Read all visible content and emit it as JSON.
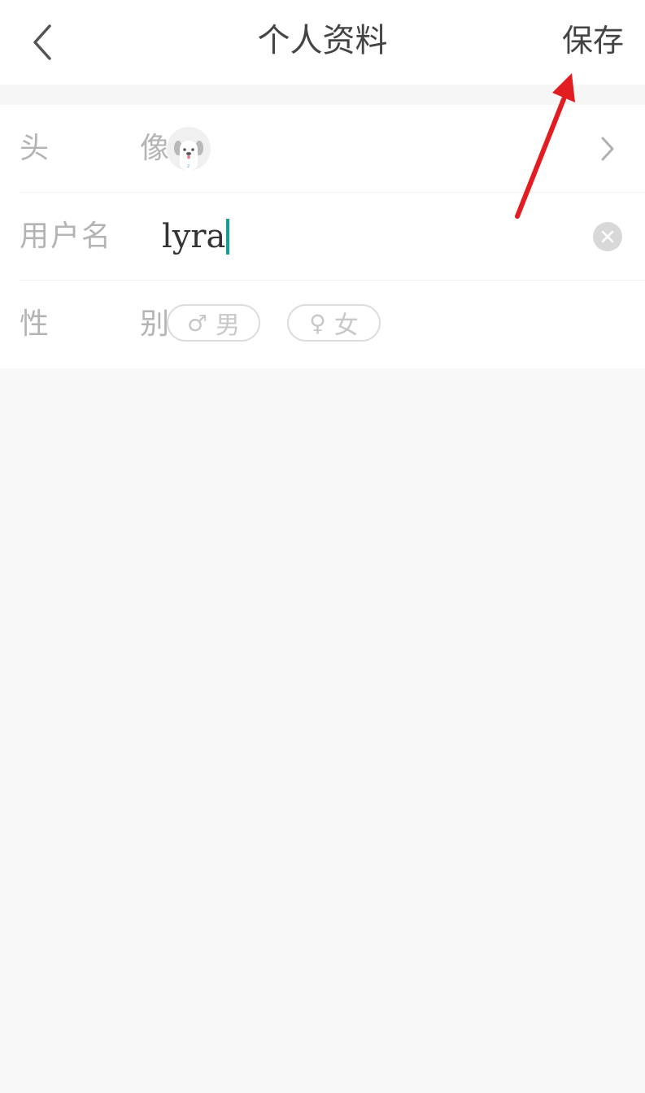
{
  "header": {
    "title": "个人资料",
    "save_label": "保存",
    "back_icon": "chevron-left-icon"
  },
  "form": {
    "avatar": {
      "label": "头　像",
      "icon": "dog-avatar-icon"
    },
    "username": {
      "label": "用户名",
      "value": "lyra"
    },
    "gender": {
      "label": "性　别",
      "options": [
        {
          "symbol": "♂",
          "label": "男"
        },
        {
          "symbol": "♀",
          "label": "女"
        }
      ]
    }
  },
  "colors": {
    "caret": "#13a08f",
    "annotation_arrow": "#e11d21",
    "label": "#b4b4b4"
  }
}
